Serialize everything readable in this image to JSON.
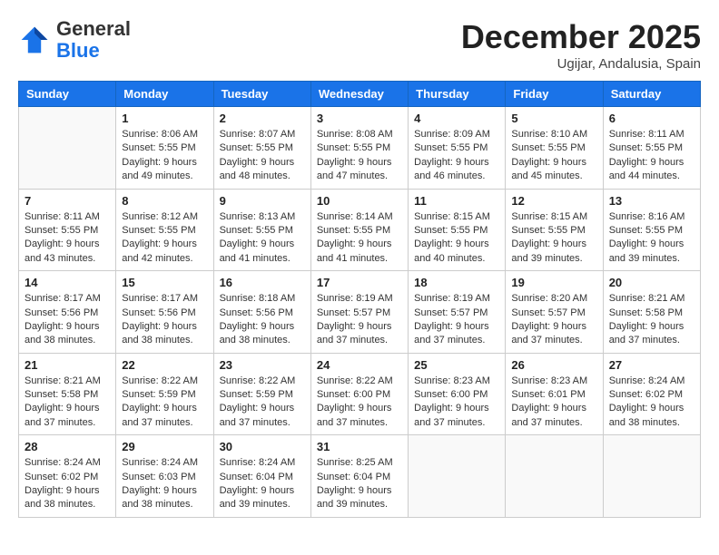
{
  "header": {
    "logo_general": "General",
    "logo_blue": "Blue",
    "month_year": "December 2025",
    "location": "Ugijar, Andalusia, Spain"
  },
  "weekdays": [
    "Sunday",
    "Monday",
    "Tuesday",
    "Wednesday",
    "Thursday",
    "Friday",
    "Saturday"
  ],
  "weeks": [
    [
      {
        "day": "",
        "empty": true
      },
      {
        "day": "1",
        "sunrise": "Sunrise: 8:06 AM",
        "sunset": "Sunset: 5:55 PM",
        "daylight": "Daylight: 9 hours and 49 minutes."
      },
      {
        "day": "2",
        "sunrise": "Sunrise: 8:07 AM",
        "sunset": "Sunset: 5:55 PM",
        "daylight": "Daylight: 9 hours and 48 minutes."
      },
      {
        "day": "3",
        "sunrise": "Sunrise: 8:08 AM",
        "sunset": "Sunset: 5:55 PM",
        "daylight": "Daylight: 9 hours and 47 minutes."
      },
      {
        "day": "4",
        "sunrise": "Sunrise: 8:09 AM",
        "sunset": "Sunset: 5:55 PM",
        "daylight": "Daylight: 9 hours and 46 minutes."
      },
      {
        "day": "5",
        "sunrise": "Sunrise: 8:10 AM",
        "sunset": "Sunset: 5:55 PM",
        "daylight": "Daylight: 9 hours and 45 minutes."
      },
      {
        "day": "6",
        "sunrise": "Sunrise: 8:11 AM",
        "sunset": "Sunset: 5:55 PM",
        "daylight": "Daylight: 9 hours and 44 minutes."
      }
    ],
    [
      {
        "day": "7",
        "sunrise": "Sunrise: 8:11 AM",
        "sunset": "Sunset: 5:55 PM",
        "daylight": "Daylight: 9 hours and 43 minutes."
      },
      {
        "day": "8",
        "sunrise": "Sunrise: 8:12 AM",
        "sunset": "Sunset: 5:55 PM",
        "daylight": "Daylight: 9 hours and 42 minutes."
      },
      {
        "day": "9",
        "sunrise": "Sunrise: 8:13 AM",
        "sunset": "Sunset: 5:55 PM",
        "daylight": "Daylight: 9 hours and 41 minutes."
      },
      {
        "day": "10",
        "sunrise": "Sunrise: 8:14 AM",
        "sunset": "Sunset: 5:55 PM",
        "daylight": "Daylight: 9 hours and 41 minutes."
      },
      {
        "day": "11",
        "sunrise": "Sunrise: 8:15 AM",
        "sunset": "Sunset: 5:55 PM",
        "daylight": "Daylight: 9 hours and 40 minutes."
      },
      {
        "day": "12",
        "sunrise": "Sunrise: 8:15 AM",
        "sunset": "Sunset: 5:55 PM",
        "daylight": "Daylight: 9 hours and 39 minutes."
      },
      {
        "day": "13",
        "sunrise": "Sunrise: 8:16 AM",
        "sunset": "Sunset: 5:55 PM",
        "daylight": "Daylight: 9 hours and 39 minutes."
      }
    ],
    [
      {
        "day": "14",
        "sunrise": "Sunrise: 8:17 AM",
        "sunset": "Sunset: 5:56 PM",
        "daylight": "Daylight: 9 hours and 38 minutes."
      },
      {
        "day": "15",
        "sunrise": "Sunrise: 8:17 AM",
        "sunset": "Sunset: 5:56 PM",
        "daylight": "Daylight: 9 hours and 38 minutes."
      },
      {
        "day": "16",
        "sunrise": "Sunrise: 8:18 AM",
        "sunset": "Sunset: 5:56 PM",
        "daylight": "Daylight: 9 hours and 38 minutes."
      },
      {
        "day": "17",
        "sunrise": "Sunrise: 8:19 AM",
        "sunset": "Sunset: 5:57 PM",
        "daylight": "Daylight: 9 hours and 37 minutes."
      },
      {
        "day": "18",
        "sunrise": "Sunrise: 8:19 AM",
        "sunset": "Sunset: 5:57 PM",
        "daylight": "Daylight: 9 hours and 37 minutes."
      },
      {
        "day": "19",
        "sunrise": "Sunrise: 8:20 AM",
        "sunset": "Sunset: 5:57 PM",
        "daylight": "Daylight: 9 hours and 37 minutes."
      },
      {
        "day": "20",
        "sunrise": "Sunrise: 8:21 AM",
        "sunset": "Sunset: 5:58 PM",
        "daylight": "Daylight: 9 hours and 37 minutes."
      }
    ],
    [
      {
        "day": "21",
        "sunrise": "Sunrise: 8:21 AM",
        "sunset": "Sunset: 5:58 PM",
        "daylight": "Daylight: 9 hours and 37 minutes."
      },
      {
        "day": "22",
        "sunrise": "Sunrise: 8:22 AM",
        "sunset": "Sunset: 5:59 PM",
        "daylight": "Daylight: 9 hours and 37 minutes."
      },
      {
        "day": "23",
        "sunrise": "Sunrise: 8:22 AM",
        "sunset": "Sunset: 5:59 PM",
        "daylight": "Daylight: 9 hours and 37 minutes."
      },
      {
        "day": "24",
        "sunrise": "Sunrise: 8:22 AM",
        "sunset": "Sunset: 6:00 PM",
        "daylight": "Daylight: 9 hours and 37 minutes."
      },
      {
        "day": "25",
        "sunrise": "Sunrise: 8:23 AM",
        "sunset": "Sunset: 6:00 PM",
        "daylight": "Daylight: 9 hours and 37 minutes."
      },
      {
        "day": "26",
        "sunrise": "Sunrise: 8:23 AM",
        "sunset": "Sunset: 6:01 PM",
        "daylight": "Daylight: 9 hours and 37 minutes."
      },
      {
        "day": "27",
        "sunrise": "Sunrise: 8:24 AM",
        "sunset": "Sunset: 6:02 PM",
        "daylight": "Daylight: 9 hours and 38 minutes."
      }
    ],
    [
      {
        "day": "28",
        "sunrise": "Sunrise: 8:24 AM",
        "sunset": "Sunset: 6:02 PM",
        "daylight": "Daylight: 9 hours and 38 minutes."
      },
      {
        "day": "29",
        "sunrise": "Sunrise: 8:24 AM",
        "sunset": "Sunset: 6:03 PM",
        "daylight": "Daylight: 9 hours and 38 minutes."
      },
      {
        "day": "30",
        "sunrise": "Sunrise: 8:24 AM",
        "sunset": "Sunset: 6:04 PM",
        "daylight": "Daylight: 9 hours and 39 minutes."
      },
      {
        "day": "31",
        "sunrise": "Sunrise: 8:25 AM",
        "sunset": "Sunset: 6:04 PM",
        "daylight": "Daylight: 9 hours and 39 minutes."
      },
      {
        "day": "",
        "empty": true
      },
      {
        "day": "",
        "empty": true
      },
      {
        "day": "",
        "empty": true
      }
    ]
  ]
}
